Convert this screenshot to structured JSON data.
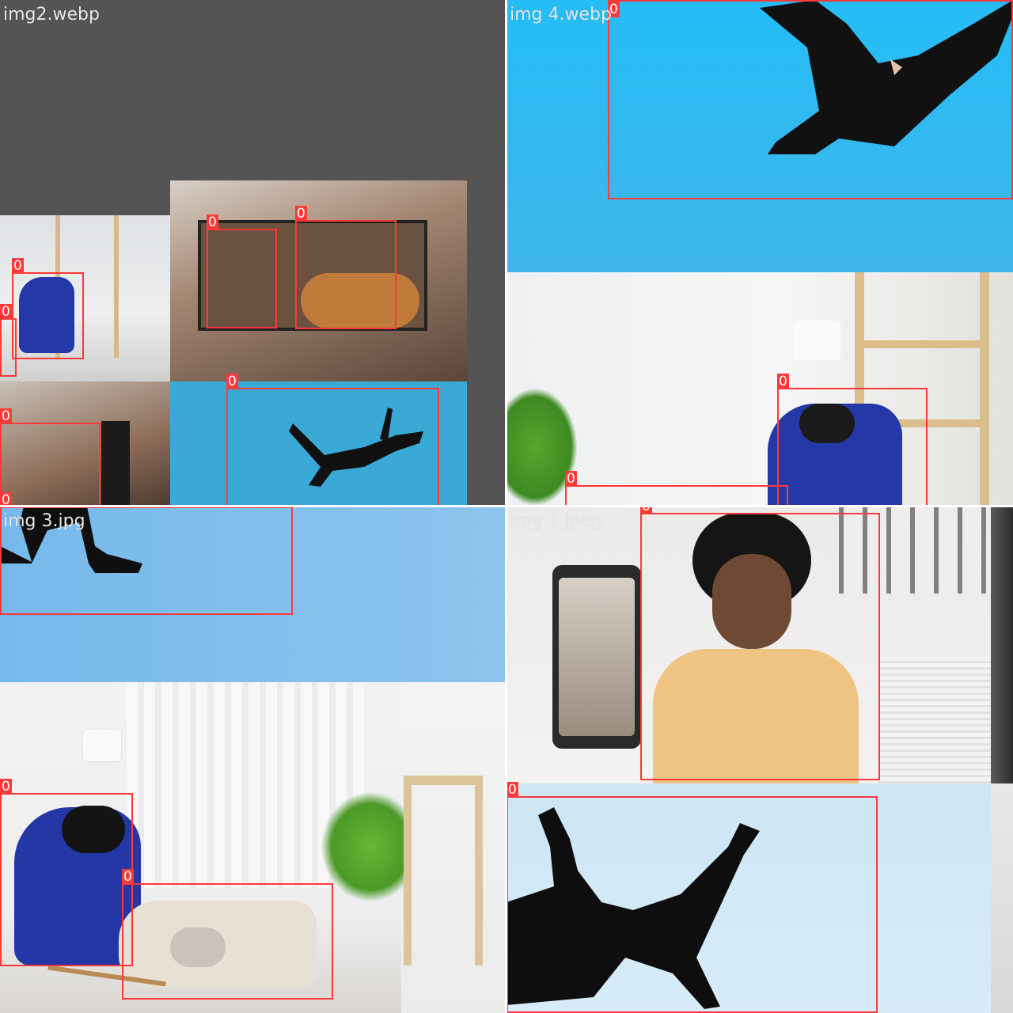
{
  "tiles": [
    {
      "title": "img2.webp"
    },
    {
      "title": "img 4.webp"
    },
    {
      "title": "img 3.jpg"
    },
    {
      "title": "img 1.jpeg"
    }
  ],
  "detection": {
    "class_label": "0",
    "box_color": "#ff3838"
  },
  "colors": {
    "gray_pad": "#545454",
    "sky": "#35b8ee",
    "sky_pale": "#cfe8f6",
    "room": "#e9ecee"
  }
}
